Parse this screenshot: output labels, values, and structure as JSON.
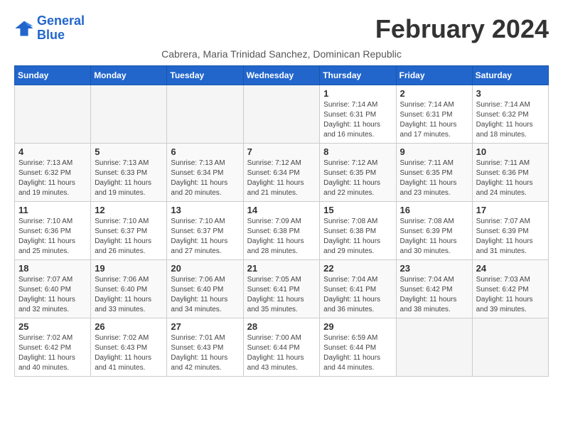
{
  "logo": {
    "line1": "General",
    "line2": "Blue"
  },
  "title": "February 2024",
  "subtitle": "Cabrera, Maria Trinidad Sanchez, Dominican Republic",
  "days_header": [
    "Sunday",
    "Monday",
    "Tuesday",
    "Wednesday",
    "Thursday",
    "Friday",
    "Saturday"
  ],
  "weeks": [
    [
      {
        "day": "",
        "info": ""
      },
      {
        "day": "",
        "info": ""
      },
      {
        "day": "",
        "info": ""
      },
      {
        "day": "",
        "info": ""
      },
      {
        "day": "1",
        "info": "Sunrise: 7:14 AM\nSunset: 6:31 PM\nDaylight: 11 hours and 16 minutes."
      },
      {
        "day": "2",
        "info": "Sunrise: 7:14 AM\nSunset: 6:31 PM\nDaylight: 11 hours and 17 minutes."
      },
      {
        "day": "3",
        "info": "Sunrise: 7:14 AM\nSunset: 6:32 PM\nDaylight: 11 hours and 18 minutes."
      }
    ],
    [
      {
        "day": "4",
        "info": "Sunrise: 7:13 AM\nSunset: 6:32 PM\nDaylight: 11 hours and 19 minutes."
      },
      {
        "day": "5",
        "info": "Sunrise: 7:13 AM\nSunset: 6:33 PM\nDaylight: 11 hours and 19 minutes."
      },
      {
        "day": "6",
        "info": "Sunrise: 7:13 AM\nSunset: 6:34 PM\nDaylight: 11 hours and 20 minutes."
      },
      {
        "day": "7",
        "info": "Sunrise: 7:12 AM\nSunset: 6:34 PM\nDaylight: 11 hours and 21 minutes."
      },
      {
        "day": "8",
        "info": "Sunrise: 7:12 AM\nSunset: 6:35 PM\nDaylight: 11 hours and 22 minutes."
      },
      {
        "day": "9",
        "info": "Sunrise: 7:11 AM\nSunset: 6:35 PM\nDaylight: 11 hours and 23 minutes."
      },
      {
        "day": "10",
        "info": "Sunrise: 7:11 AM\nSunset: 6:36 PM\nDaylight: 11 hours and 24 minutes."
      }
    ],
    [
      {
        "day": "11",
        "info": "Sunrise: 7:10 AM\nSunset: 6:36 PM\nDaylight: 11 hours and 25 minutes."
      },
      {
        "day": "12",
        "info": "Sunrise: 7:10 AM\nSunset: 6:37 PM\nDaylight: 11 hours and 26 minutes."
      },
      {
        "day": "13",
        "info": "Sunrise: 7:10 AM\nSunset: 6:37 PM\nDaylight: 11 hours and 27 minutes."
      },
      {
        "day": "14",
        "info": "Sunrise: 7:09 AM\nSunset: 6:38 PM\nDaylight: 11 hours and 28 minutes."
      },
      {
        "day": "15",
        "info": "Sunrise: 7:08 AM\nSunset: 6:38 PM\nDaylight: 11 hours and 29 minutes."
      },
      {
        "day": "16",
        "info": "Sunrise: 7:08 AM\nSunset: 6:39 PM\nDaylight: 11 hours and 30 minutes."
      },
      {
        "day": "17",
        "info": "Sunrise: 7:07 AM\nSunset: 6:39 PM\nDaylight: 11 hours and 31 minutes."
      }
    ],
    [
      {
        "day": "18",
        "info": "Sunrise: 7:07 AM\nSunset: 6:40 PM\nDaylight: 11 hours and 32 minutes."
      },
      {
        "day": "19",
        "info": "Sunrise: 7:06 AM\nSunset: 6:40 PM\nDaylight: 11 hours and 33 minutes."
      },
      {
        "day": "20",
        "info": "Sunrise: 7:06 AM\nSunset: 6:40 PM\nDaylight: 11 hours and 34 minutes."
      },
      {
        "day": "21",
        "info": "Sunrise: 7:05 AM\nSunset: 6:41 PM\nDaylight: 11 hours and 35 minutes."
      },
      {
        "day": "22",
        "info": "Sunrise: 7:04 AM\nSunset: 6:41 PM\nDaylight: 11 hours and 36 minutes."
      },
      {
        "day": "23",
        "info": "Sunrise: 7:04 AM\nSunset: 6:42 PM\nDaylight: 11 hours and 38 minutes."
      },
      {
        "day": "24",
        "info": "Sunrise: 7:03 AM\nSunset: 6:42 PM\nDaylight: 11 hours and 39 minutes."
      }
    ],
    [
      {
        "day": "25",
        "info": "Sunrise: 7:02 AM\nSunset: 6:42 PM\nDaylight: 11 hours and 40 minutes."
      },
      {
        "day": "26",
        "info": "Sunrise: 7:02 AM\nSunset: 6:43 PM\nDaylight: 11 hours and 41 minutes."
      },
      {
        "day": "27",
        "info": "Sunrise: 7:01 AM\nSunset: 6:43 PM\nDaylight: 11 hours and 42 minutes."
      },
      {
        "day": "28",
        "info": "Sunrise: 7:00 AM\nSunset: 6:44 PM\nDaylight: 11 hours and 43 minutes."
      },
      {
        "day": "29",
        "info": "Sunrise: 6:59 AM\nSunset: 6:44 PM\nDaylight: 11 hours and 44 minutes."
      },
      {
        "day": "",
        "info": ""
      },
      {
        "day": "",
        "info": ""
      }
    ]
  ]
}
